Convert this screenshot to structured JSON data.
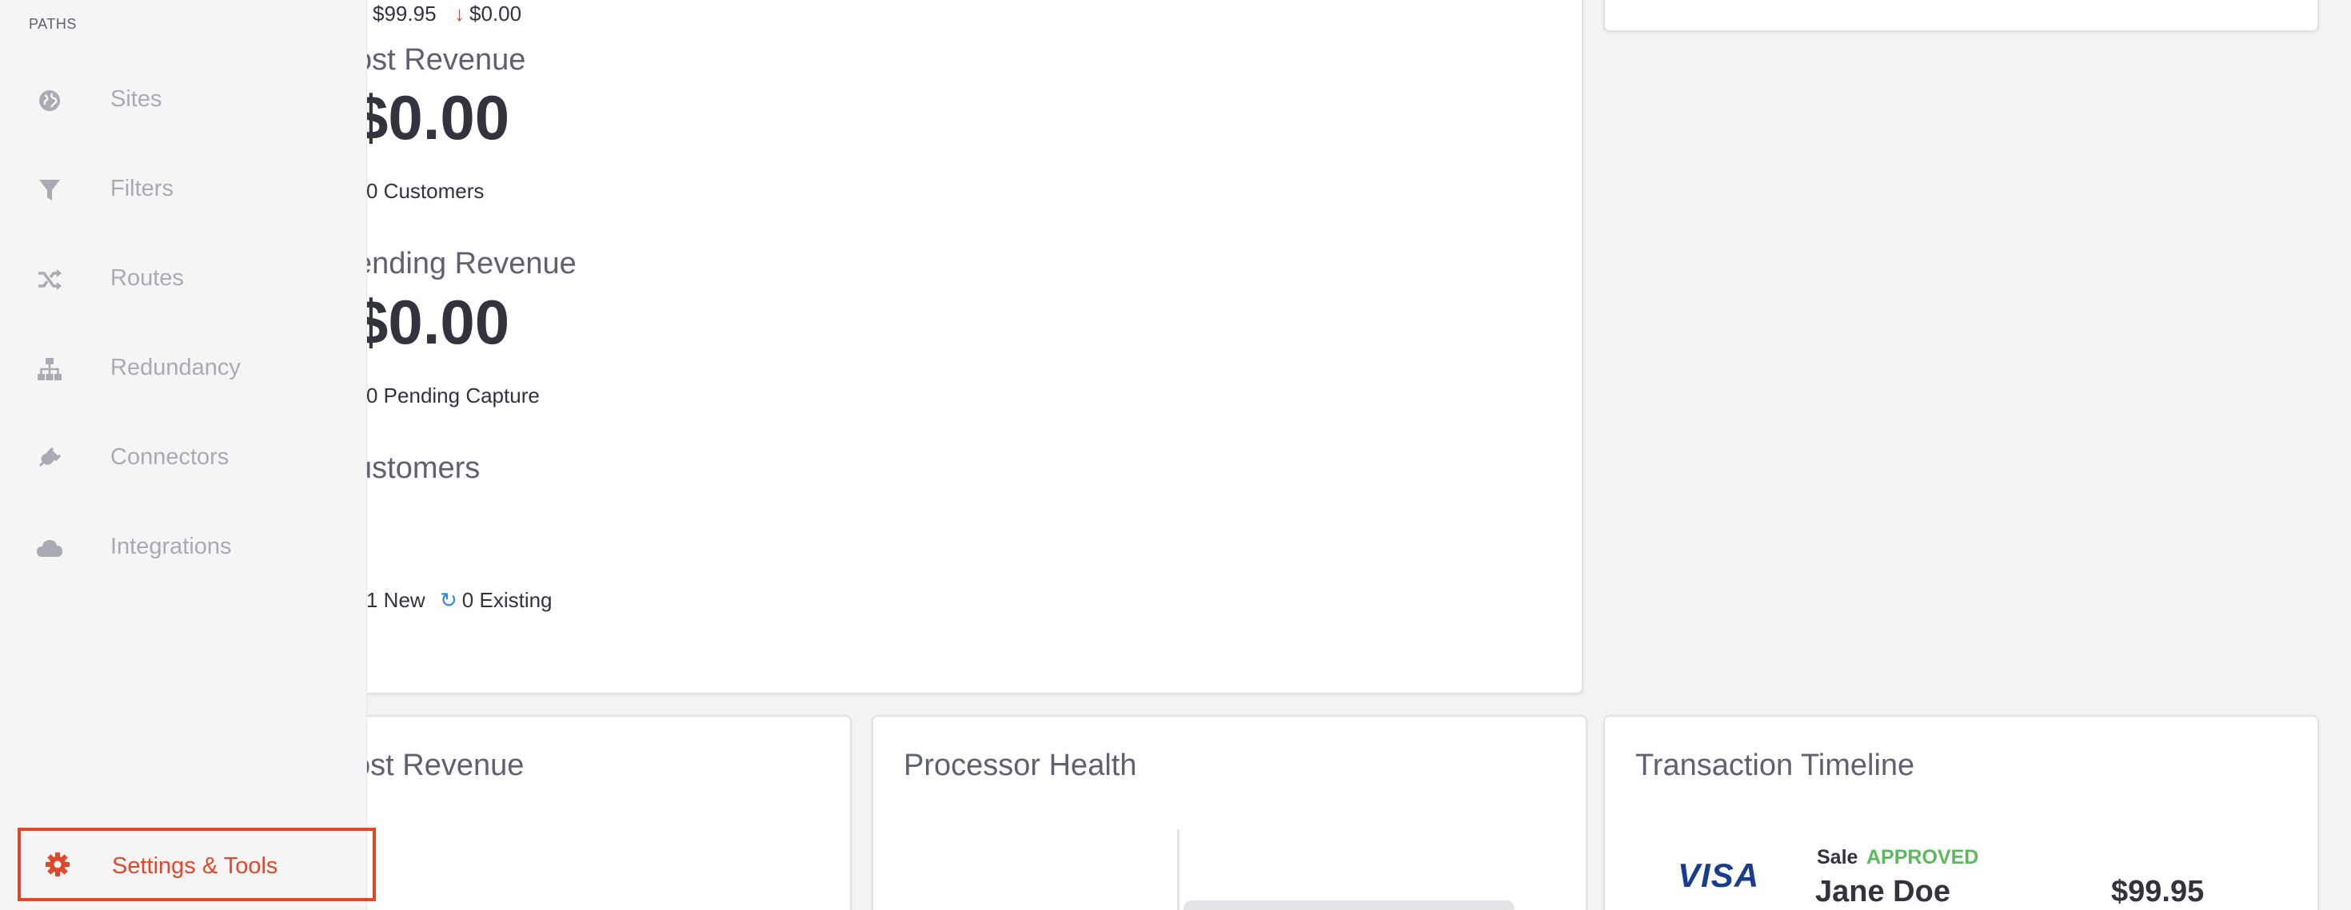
{
  "sidebar": {
    "heading": "PATHS",
    "items": [
      {
        "label": "Sites",
        "icon": "globe-icon"
      },
      {
        "label": "Filters",
        "icon": "filter-icon"
      },
      {
        "label": "Routes",
        "icon": "shuffle-icon"
      },
      {
        "label": "Redundancy",
        "icon": "sitemap-icon"
      },
      {
        "label": "Connectors",
        "icon": "plug-icon"
      },
      {
        "label": "Integrations",
        "icon": "cloud-icon"
      }
    ],
    "settings": {
      "label": "Settings & Tools",
      "icon": "gear-icon"
    }
  },
  "main_card": {
    "top_row": {
      "amount": "$99.95",
      "change": "$0.00"
    },
    "lost_revenue": {
      "label": "ost Revenue",
      "value": "$0.00",
      "sub": "0 Customers"
    },
    "pending_revenue": {
      "label": "ending Revenue",
      "value": "$0.00",
      "sub": "0 Pending Capture"
    },
    "customers": {
      "label": "ustomers",
      "new": "1 New",
      "existing": "0 Existing"
    }
  },
  "bottom_cards": {
    "lost_revenue_title": "ost Revenue",
    "processor_health_title": "Processor Health",
    "timeline": {
      "title": "Transaction Timeline",
      "card_brand": "VISA",
      "type": "Sale",
      "status": "APPROVED",
      "name": "Jane Doe",
      "amount": "$99.95"
    }
  },
  "colors": {
    "accent": "#e2472a",
    "approved": "#5cb85c",
    "visa": "#1a3c8f",
    "sync": "#2e86de"
  }
}
